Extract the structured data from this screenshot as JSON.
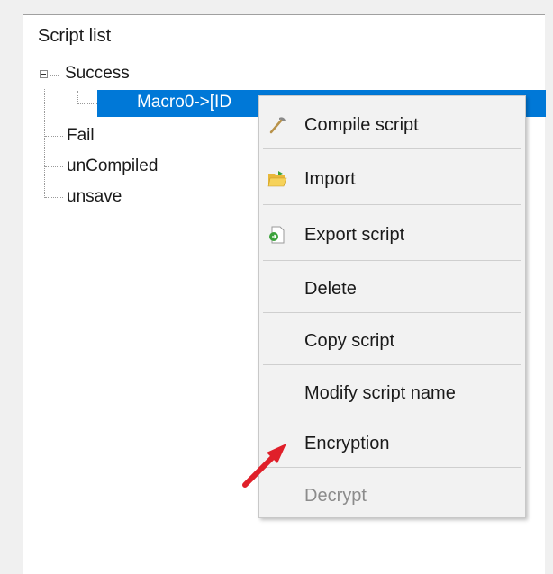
{
  "panel": {
    "title": "Script list"
  },
  "tree": {
    "nodes": [
      {
        "label": "Success"
      },
      {
        "label": "Macro0->[ID"
      },
      {
        "label": "Fail"
      },
      {
        "label": "unCompiled"
      },
      {
        "label": "unsave"
      }
    ]
  },
  "context_menu": {
    "items": [
      {
        "label": "Compile script",
        "icon": "compile-icon",
        "enabled": true
      },
      {
        "label": "Import",
        "icon": "folder-open-icon",
        "enabled": true
      },
      {
        "label": "Export script",
        "icon": "export-icon",
        "enabled": true
      },
      {
        "label": "Delete",
        "enabled": true
      },
      {
        "label": "Copy script",
        "enabled": true
      },
      {
        "label": "Modify script name",
        "enabled": true
      },
      {
        "label": "Encryption",
        "enabled": true
      },
      {
        "label": "Decrypt",
        "enabled": false
      }
    ]
  },
  "colors": {
    "selection": "#0078d7",
    "annotation_arrow": "#e0202a"
  }
}
